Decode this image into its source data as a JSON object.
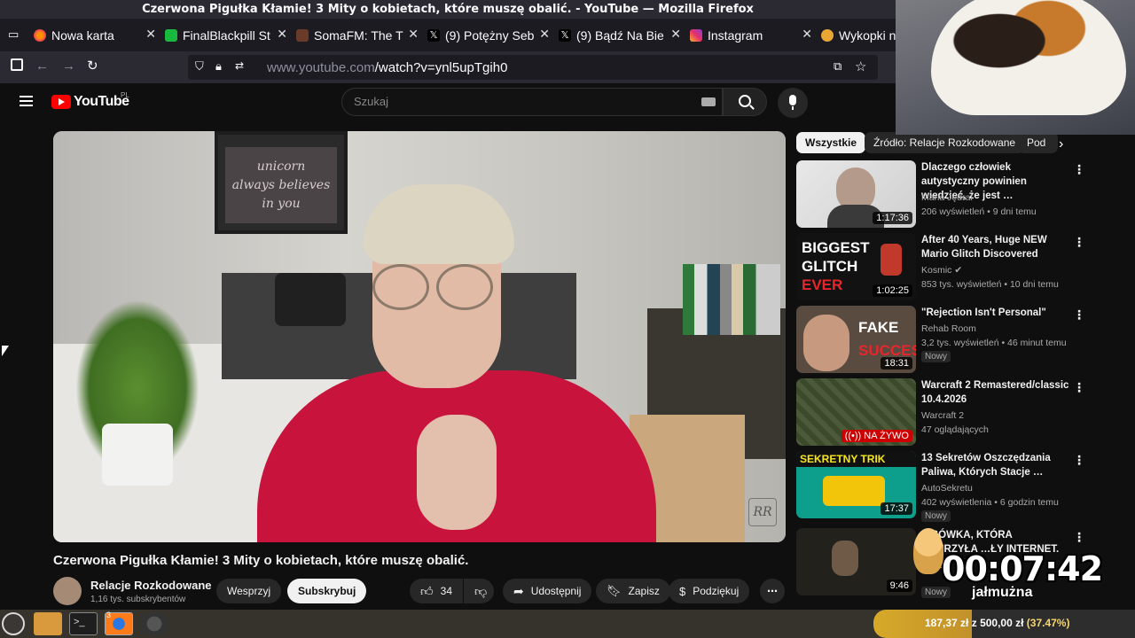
{
  "window": {
    "title": "Czerwona Pigułka Kłamie! 3 Mity o kobietach, które muszę obalić. - YouTube — Mozilla Firefox"
  },
  "tabs": [
    {
      "label": "Nowa karta"
    },
    {
      "label": "FinalBlackpill St"
    },
    {
      "label": "SomaFM: The T"
    },
    {
      "label": "(9) Potężny Seb"
    },
    {
      "label": "(9) Bądź Na Bie"
    },
    {
      "label": "Instagram"
    },
    {
      "label": "Wykopki n"
    }
  ],
  "nav": {
    "url_host": "www.youtube.com",
    "url_path": "/watch?v=ynl5upTgih0"
  },
  "youtube": {
    "logo": "YouTube",
    "region": "PL",
    "search_placeholder": "Szukaj"
  },
  "video": {
    "title": "Czerwona Pigułka Kłamie! 3 Mity o kobietach, które muszę obalić.",
    "channel": "Relacje Rozkodowane",
    "subscribers": "1,16 tys. subskrybentów",
    "support_label": "Wesprzyj",
    "subscribe_label": "Subskrybuj",
    "likes": "34",
    "share_label": "Udostępnij",
    "save_label": "Zapisz",
    "thanks_label": "Podziękuj",
    "poster_text": [
      "unicorn",
      "always believes",
      "in you"
    ],
    "watermark": "RR"
  },
  "chips": [
    "Wszystkie",
    "Źródło: Relacje Rozkodowane",
    "Pod"
  ],
  "recommendations": [
    {
      "title": "Dlaczego człowiek autystyczny powinien wiedzieć, że jest …",
      "channel": "Maria Jędral",
      "meta": "206 wyświetleń • 9 dni temu",
      "duration": "1:17:36",
      "badge": ""
    },
    {
      "title": "After 40 Years, Huge NEW Mario Glitch Discovered",
      "channel": "Kosmic",
      "meta": "853 tys. wyświetleń • 10 dni temu",
      "duration": "1:02:25",
      "badge": "",
      "thumb_text": [
        "BIGGEST",
        "GLITCH",
        "EVER"
      ]
    },
    {
      "title": "\"Rejection Isn't Personal\"",
      "channel": "Rehab Room",
      "meta": "3,2 tys. wyświetleń • 46 minut temu",
      "duration": "18:31",
      "badge": "Nowy",
      "thumb_text": [
        "FAKE",
        "SUCCESS"
      ]
    },
    {
      "title": "Warcraft 2 Remastered/classic 10.4.2026",
      "channel": "Warcraft 2",
      "meta": "47 oglądających",
      "duration": "NA ŻYWO",
      "badge": ""
    },
    {
      "title": "13 Sekretów Oszczędzania Paliwa, Których Stacje …",
      "channel": "AutoSekretu",
      "meta": "402 wyświetlenia • 6 godzin temu",
      "duration": "17:37",
      "badge": "Nowy",
      "thumb_text": [
        "SEKRETNY TRIK"
      ]
    },
    {
      "title": "…SÓWKA, KTÓRA OBURZYŁA …ŁY INTERNET.",
      "channel": "…ADS",
      "meta": "",
      "duration": "9:46",
      "badge": "Nowy"
    }
  ],
  "overlay": {
    "timer": "00:07:42",
    "label": "jałmużna",
    "goal_current": "187,37 zł",
    "goal_sep": "z",
    "goal_total": "500,00 zł",
    "goal_percent": "(37.47%)",
    "goal_fraction": 0.3747
  },
  "taskbar": {
    "badge": "3"
  }
}
